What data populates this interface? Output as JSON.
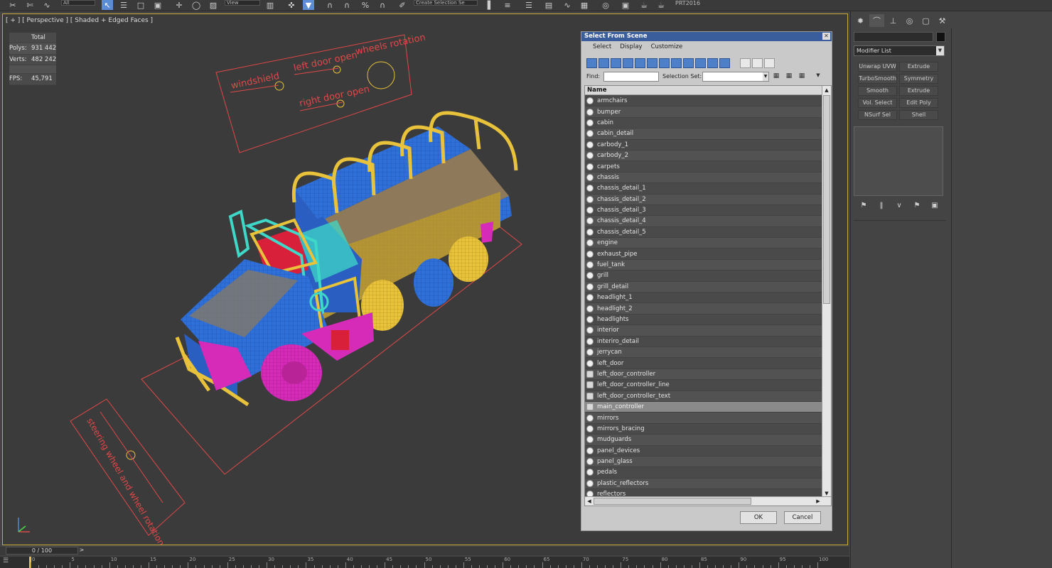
{
  "toolbar": {
    "filter_value": "All",
    "refcoord_value": "View",
    "selection_set": "Create Selection Se",
    "project_label": "PRT2016"
  },
  "viewport": {
    "label": "[ + ] [ Perspective ] [ Shaded + Edged Faces ]",
    "stats": {
      "total_label": "Total",
      "polys_label": "Polys:",
      "polys_value": "931 442",
      "verts_label": "Verts:",
      "verts_value": "482 242",
      "fps_label": "FPS:",
      "fps_value": "45,791"
    },
    "scene_labels": {
      "windshield": "windshield",
      "left_door_open": "left door open",
      "wheels_rotation": "wheels rotation",
      "right_door_open": "right door open",
      "steering": "steering wheel and wheel rotation"
    },
    "colors": {
      "wire_blue": "#2f6fd8",
      "wire_yellow": "#e8c23a",
      "wire_magenta": "#d62ab8",
      "wire_cyan": "#3fd8c8",
      "wire_red": "#d8203a",
      "helper_red": "#e04848"
    }
  },
  "timeline": {
    "frame": "0 / 100",
    "next": ">",
    "ticks": [
      "0",
      "5",
      "10",
      "15",
      "20",
      "25",
      "30",
      "35",
      "40",
      "45",
      "50",
      "55",
      "60",
      "65",
      "70",
      "75",
      "80",
      "85",
      "90",
      "95",
      "100"
    ]
  },
  "command_panel": {
    "modifier_list": "Modifier List",
    "buttons": [
      "Unwrap UVW",
      "Extrude",
      "TurboSmooth",
      "Symmetry",
      "Smooth",
      "Extrude",
      "Vol. Select",
      "Edit Poly",
      "NSurf Sel",
      "Shell"
    ]
  },
  "dialog": {
    "title": "Select From Scene",
    "menu": [
      "Select",
      "Display",
      "Customize"
    ],
    "find_label": "Find:",
    "selection_set_label": "Selection Set:",
    "column_name": "Name",
    "items": [
      {
        "name": "armchairs",
        "type": "geo"
      },
      {
        "name": "bumper",
        "type": "geo"
      },
      {
        "name": "cabin",
        "type": "geo"
      },
      {
        "name": "cabin_detail",
        "type": "geo"
      },
      {
        "name": "carbody_1",
        "type": "geo"
      },
      {
        "name": "carbody_2",
        "type": "geo"
      },
      {
        "name": "carpets",
        "type": "geo"
      },
      {
        "name": "chassis",
        "type": "geo"
      },
      {
        "name": "chassis_detail_1",
        "type": "geo"
      },
      {
        "name": "chassis_detail_2",
        "type": "geo"
      },
      {
        "name": "chassis_detail_3",
        "type": "geo"
      },
      {
        "name": "chassis_detail_4",
        "type": "geo"
      },
      {
        "name": "chassis_detail_5",
        "type": "geo"
      },
      {
        "name": "engine",
        "type": "geo"
      },
      {
        "name": "exhaust_pipe",
        "type": "geo"
      },
      {
        "name": "fuel_tank",
        "type": "geo"
      },
      {
        "name": "grill",
        "type": "geo"
      },
      {
        "name": "grill_detail",
        "type": "geo"
      },
      {
        "name": "headlight_1",
        "type": "geo"
      },
      {
        "name": "headlight_2",
        "type": "geo"
      },
      {
        "name": "headlights",
        "type": "geo"
      },
      {
        "name": "interior",
        "type": "geo"
      },
      {
        "name": "interiro_detail",
        "type": "geo"
      },
      {
        "name": "jerrycan",
        "type": "geo"
      },
      {
        "name": "left_door",
        "type": "geo"
      },
      {
        "name": "left_door_controller",
        "type": "helper"
      },
      {
        "name": "left_door_controller_line",
        "type": "helper"
      },
      {
        "name": "left_door_controller_text",
        "type": "helper"
      },
      {
        "name": "main_controller",
        "type": "helper",
        "selected": true
      },
      {
        "name": "mirrors",
        "type": "geo"
      },
      {
        "name": "mirrors_bracing",
        "type": "geo"
      },
      {
        "name": "mudguards",
        "type": "geo"
      },
      {
        "name": "panel_devices",
        "type": "geo"
      },
      {
        "name": "panel_glass",
        "type": "geo"
      },
      {
        "name": "pedals",
        "type": "geo"
      },
      {
        "name": "plastic_reflectors",
        "type": "geo"
      },
      {
        "name": "reflectors",
        "type": "geo"
      }
    ],
    "ok_label": "OK",
    "cancel_label": "Cancel"
  }
}
